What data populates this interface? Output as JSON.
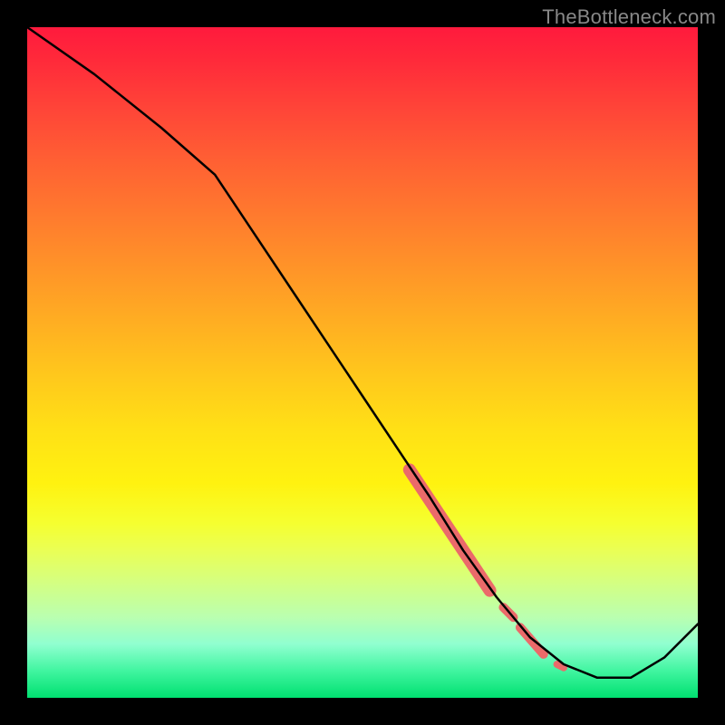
{
  "watermark": "TheBottleneck.com",
  "chart_data": {
    "type": "line",
    "title": "",
    "xlabel": "",
    "ylabel": "",
    "xlim": [
      0,
      100
    ],
    "ylim": [
      0,
      100
    ],
    "grid": false,
    "legend": false,
    "background_gradient": {
      "top_color": "#ff1a3d",
      "mid_color": "#ffe016",
      "bottom_color": "#00e070"
    },
    "series": [
      {
        "name": "main-curve",
        "color": "#000000",
        "x": [
          0,
          10,
          20,
          28,
          40,
          50,
          60,
          65,
          70,
          75,
          80,
          85,
          90,
          95,
          100
        ],
        "y": [
          100,
          93,
          85,
          78,
          60,
          45,
          30,
          22,
          15,
          9,
          5,
          3,
          3,
          6,
          11
        ]
      }
    ],
    "highlight_segments": [
      {
        "name": "highlight-thick-1",
        "color": "#eb6a6a",
        "width": 14,
        "x": [
          57,
          69
        ],
        "y": [
          34,
          16
        ]
      },
      {
        "name": "highlight-dot-1",
        "color": "#eb6a6a",
        "width": 10,
        "x": [
          71,
          72.5
        ],
        "y": [
          13.5,
          12
        ]
      },
      {
        "name": "highlight-short-1",
        "color": "#eb6a6a",
        "width": 10,
        "x": [
          73.5,
          77
        ],
        "y": [
          10.5,
          6.5
        ]
      },
      {
        "name": "highlight-dot-2",
        "color": "#eb6a6a",
        "width": 8,
        "x": [
          79,
          80
        ],
        "y": [
          5,
          4.5
        ]
      }
    ]
  }
}
